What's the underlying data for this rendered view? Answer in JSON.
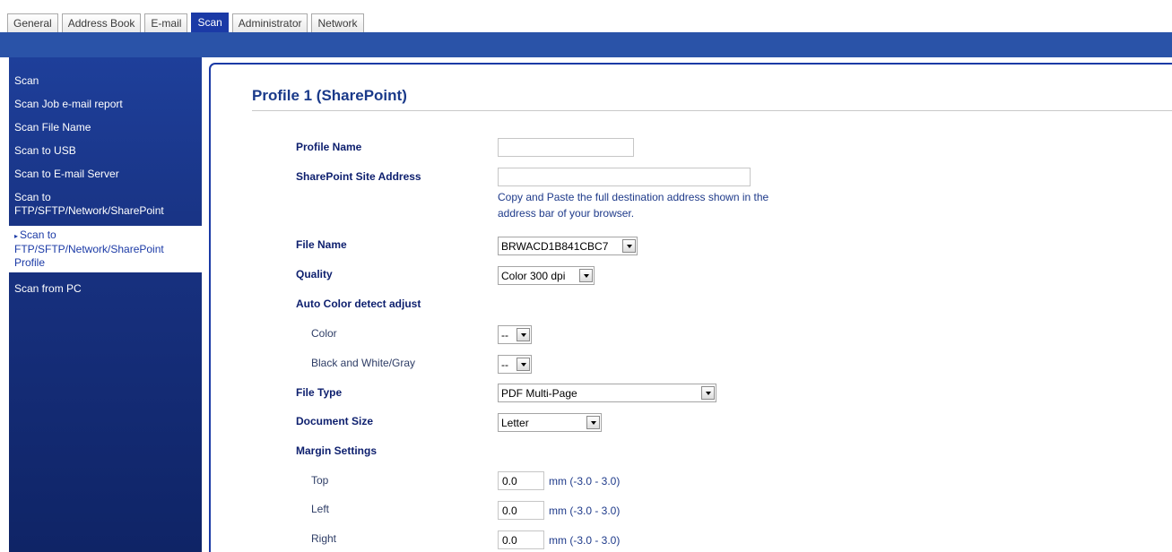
{
  "tabs": [
    "General",
    "Address Book",
    "E-mail",
    "Scan",
    "Administrator",
    "Network"
  ],
  "sidebar": {
    "items": [
      {
        "label": "Scan"
      },
      {
        "label": "Scan Job e-mail report"
      },
      {
        "label": "Scan File Name"
      },
      {
        "label": "Scan to USB"
      },
      {
        "label": "Scan to E-mail Server"
      },
      {
        "label": "Scan to FTP/SFTP/Network/SharePoint"
      },
      {
        "label": "Scan to FTP/SFTP/Network/SharePoint Profile"
      },
      {
        "label": "Scan from PC"
      }
    ],
    "selected_marker": "▸"
  },
  "page": {
    "title": "Profile 1 (SharePoint)"
  },
  "form": {
    "profile_name": {
      "label": "Profile Name",
      "value": ""
    },
    "site_address": {
      "label": "SharePoint Site Address",
      "value": "",
      "help": "Copy and Paste the full destination address shown in the address bar of your browser."
    },
    "file_name": {
      "label": "File Name",
      "value": "BRWACD1B841CBC7"
    },
    "quality": {
      "label": "Quality",
      "value": "Color 300 dpi"
    },
    "auto_color": {
      "label": "Auto Color detect adjust"
    },
    "color": {
      "label": "Color",
      "value": "--"
    },
    "bw_gray": {
      "label": "Black and White/Gray",
      "value": "--"
    },
    "file_type": {
      "label": "File Type",
      "value": "PDF Multi-Page"
    },
    "document_size": {
      "label": "Document Size",
      "value": "Letter"
    },
    "margin": {
      "label": "Margin Settings"
    },
    "top": {
      "label": "Top",
      "value": "0.0",
      "unit": "mm (-3.0 - 3.0)"
    },
    "left": {
      "label": "Left",
      "value": "0.0",
      "unit": "mm (-3.0 - 3.0)"
    },
    "right": {
      "label": "Right",
      "value": "0.0",
      "unit": "mm (-3.0 - 3.0)"
    }
  }
}
